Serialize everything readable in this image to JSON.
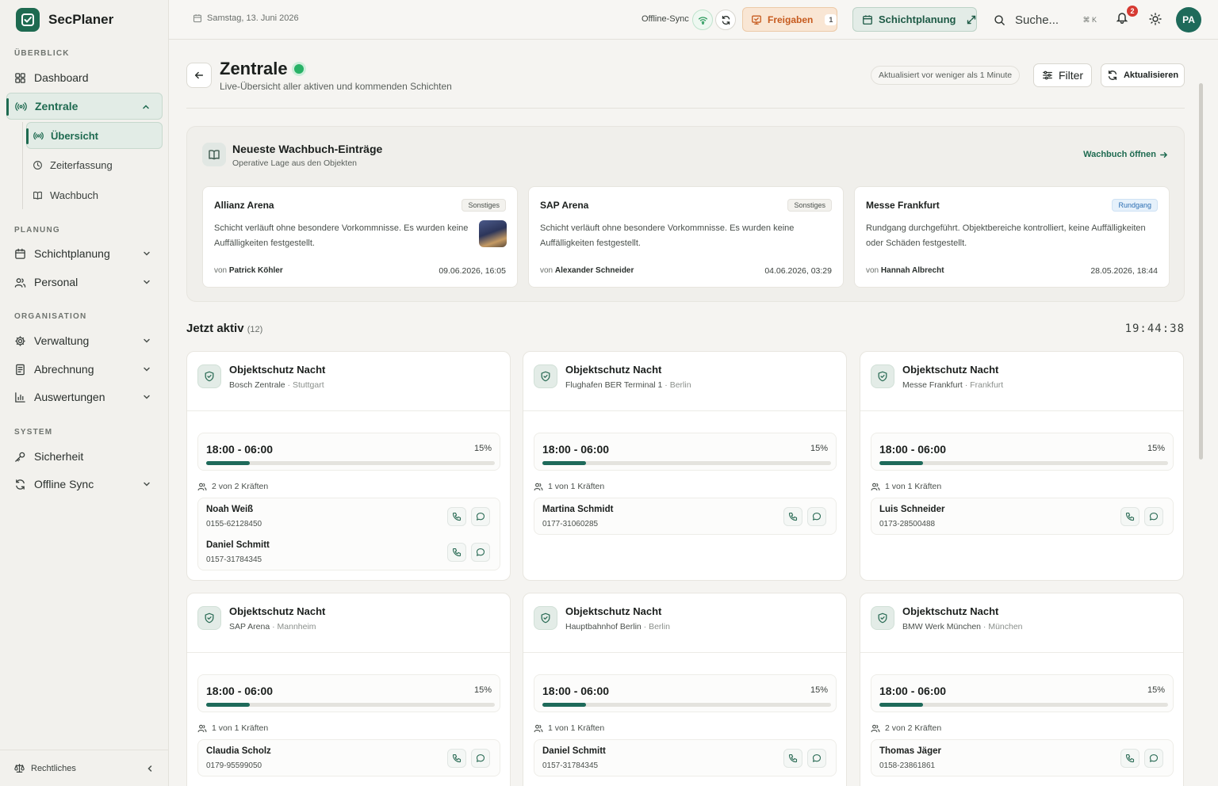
{
  "app": {
    "name": "SecPlaner"
  },
  "sidebar": {
    "sections": {
      "overview": "ÜBERBLICK",
      "planning": "PLANUNG",
      "organisation": "ORGANISATION",
      "system": "SYSTEM"
    },
    "items": {
      "dashboard": "Dashboard",
      "zentrale": "Zentrale",
      "uebersicht": "Übersicht",
      "zeiterfassung": "Zeiterfassung",
      "wachbuch": "Wachbuch",
      "schichtplanung": "Schichtplanung",
      "personal": "Personal",
      "verwaltung": "Verwaltung",
      "abrechnung": "Abrechnung",
      "auswertungen": "Auswertungen",
      "sicherheit": "Sicherheit",
      "offline_sync": "Offline Sync"
    },
    "footer": "Rechtliches"
  },
  "topbar": {
    "date": "Samstag, 13. Juni 2026",
    "offline_label": "Offline-Sync",
    "freigaben_label": "Freigaben",
    "freigaben_count": "1",
    "schichtplanung_label": "Schichtplanung",
    "search_placeholder": "Suche...",
    "search_shortcut": "⌘ K",
    "notifications_count": "2",
    "avatar_initials": "PA"
  },
  "page": {
    "title": "Zentrale",
    "subtitle": "Live-Übersicht aller aktiven und kommenden Schichten",
    "updated": "Aktualisiert vor weniger als 1 Minute",
    "filter_label": "Filter",
    "refresh_label": "Aktualisieren"
  },
  "wachbuch": {
    "title": "Neueste Wachbuch-Einträge",
    "subtitle": "Operative Lage aus den Objekten",
    "link": "Wachbuch öffnen",
    "entries": [
      {
        "name": "Allianz Arena",
        "tag": "Sonstiges",
        "text": "Schicht verläuft ohne besondere Vorkommnisse. Es wurden keine Auffälligkeiten festgestellt.",
        "from_prefix": "von",
        "author": "Patrick Köhler",
        "date": "09.06.2026, 16:05"
      },
      {
        "name": "SAP Arena",
        "tag": "Sonstiges",
        "text": "Schicht verläuft ohne besondere Vorkommnisse. Es wurden keine Auffälligkeiten festgestellt.",
        "from_prefix": "von",
        "author": "Alexander Schneider",
        "date": "04.06.2026, 03:29"
      },
      {
        "name": "Messe Frankfurt",
        "tag": "Rundgang",
        "text": "Rundgang durchgeführt. Objektbereiche kontrolliert, keine Auffälligkeiten oder Schäden festgestellt.",
        "from_prefix": "von",
        "author": "Hannah Albrecht",
        "date": "28.05.2026, 18:44"
      }
    ]
  },
  "active": {
    "title": "Jetzt aktiv",
    "count": "(12)",
    "clock": "19:44:38",
    "shifts": [
      {
        "name": "Objektschutz Nacht",
        "location": "Bosch Zentrale",
        "city": " · Stuttgart",
        "time": "18:00 - 06:00",
        "progress_pct": 15,
        "progress_label": "15%",
        "staff_count": "2 von 2 Kräften",
        "staff": [
          {
            "name": "Noah Weiß",
            "phone": "0155-62128450"
          },
          {
            "name": "Daniel Schmitt",
            "phone": "0157-31784345"
          }
        ]
      },
      {
        "name": "Objektschutz Nacht",
        "location": "Flughafen BER Terminal 1",
        "city": " · Berlin",
        "time": "18:00 - 06:00",
        "progress_pct": 15,
        "progress_label": "15%",
        "staff_count": "1 von 1 Kräften",
        "staff": [
          {
            "name": "Martina Schmidt",
            "phone": "0177-31060285"
          }
        ]
      },
      {
        "name": "Objektschutz Nacht",
        "location": "Messe Frankfurt",
        "city": " · Frankfurt",
        "time": "18:00 - 06:00",
        "progress_pct": 15,
        "progress_label": "15%",
        "staff_count": "1 von 1 Kräften",
        "staff": [
          {
            "name": "Luis Schneider",
            "phone": "0173-28500488"
          }
        ]
      },
      {
        "name": "Objektschutz Nacht",
        "location": "SAP Arena",
        "city": " · Mannheim",
        "time": "18:00 - 06:00",
        "progress_pct": 15,
        "progress_label": "15%",
        "staff_count": "1 von 1 Kräften",
        "staff": [
          {
            "name": "Claudia Scholz",
            "phone": "0179-95599050"
          }
        ]
      },
      {
        "name": "Objektschutz Nacht",
        "location": "Hauptbahnhof Berlin",
        "city": " · Berlin",
        "time": "18:00 - 06:00",
        "progress_pct": 15,
        "progress_label": "15%",
        "staff_count": "1 von 1 Kräften",
        "staff": [
          {
            "name": "Daniel Schmitt",
            "phone": "0157-31784345"
          }
        ]
      },
      {
        "name": "Objektschutz Nacht",
        "location": "BMW Werk München",
        "city": " · München",
        "time": "18:00 - 06:00",
        "progress_pct": 15,
        "progress_label": "15%",
        "staff_count": "2 von 2 Kräften",
        "staff": [
          {
            "name": "Thomas Jäger",
            "phone": "0158-23861861"
          }
        ]
      }
    ]
  },
  "colors": {
    "brand": "#1e6a50",
    "accent_orange": "#c65a1e",
    "live": "#28b267",
    "badge_red": "#d63a32"
  },
  "icons": [
    "calendar-icon",
    "wifi-icon",
    "sync-icon",
    "approval-icon",
    "search-icon",
    "bell-icon",
    "sun-icon",
    "arrow-left-icon",
    "filter-icon",
    "refresh-icon",
    "book-icon",
    "shield-icon",
    "users-icon",
    "phone-icon",
    "message-icon"
  ]
}
